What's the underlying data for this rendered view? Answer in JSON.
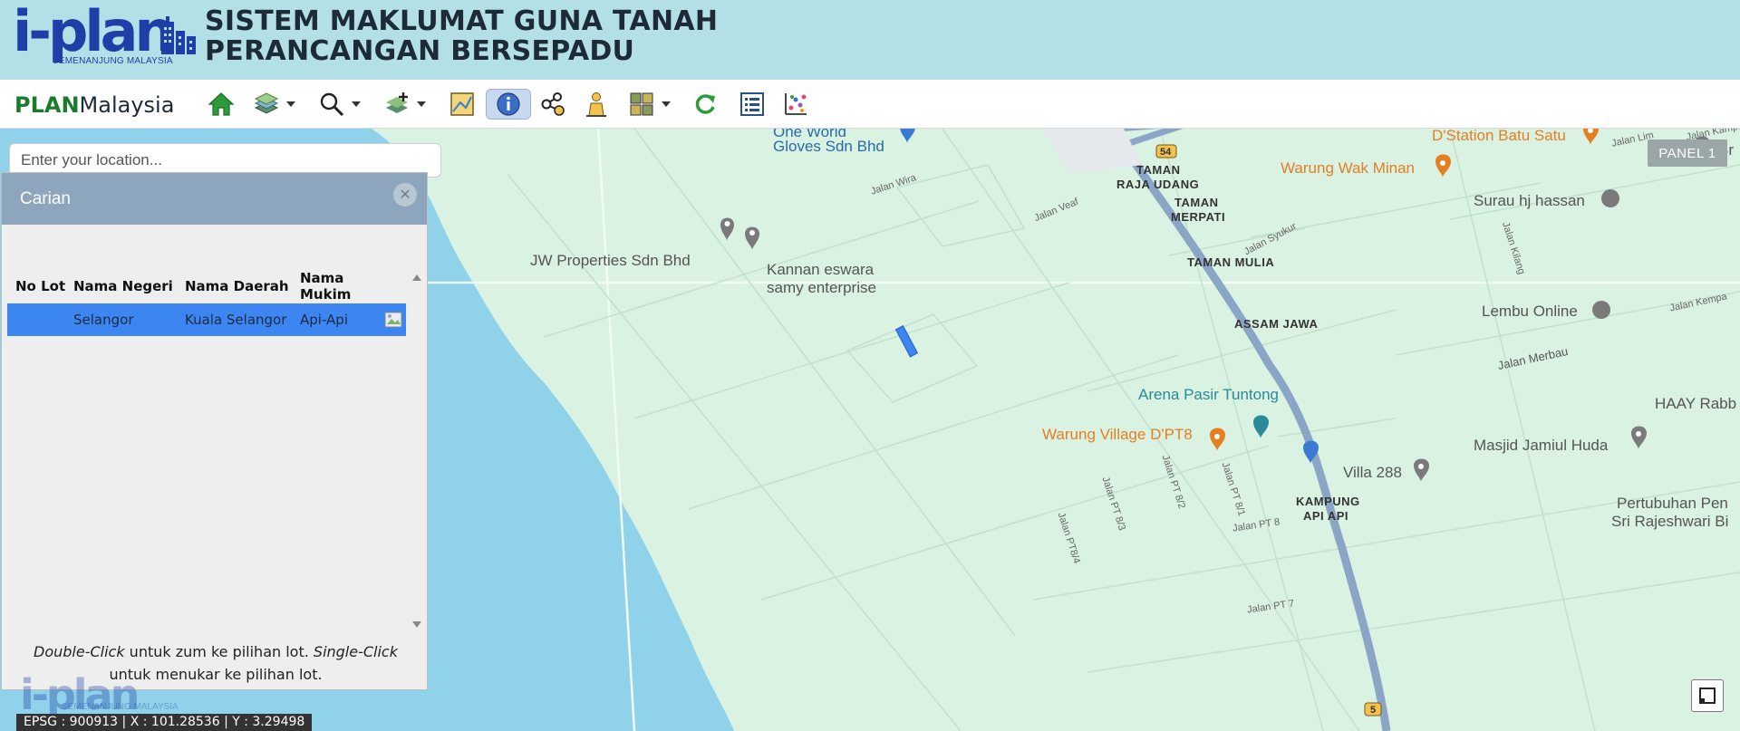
{
  "header": {
    "logo_text": "i-plan",
    "logo_subtitle": "SEMENANJUNG MALAYSIA",
    "title_line1": "SISTEM MAKLUMAT GUNA TANAH",
    "title_line2": "PERANCANGAN BERSEPADU"
  },
  "toolbar": {
    "brand_prefix": "PLAN",
    "brand_suffix": "Malaysia",
    "icons": [
      "home-icon",
      "layers-icon",
      "search-zoom-icon",
      "add-layer-icon",
      "map-legend-icon",
      "info-icon",
      "share-icon",
      "person-icon",
      "grid-icon",
      "refresh-icon",
      "list-icon",
      "chart-icon"
    ]
  },
  "location_search": {
    "placeholder": "Enter your location..."
  },
  "carian": {
    "title": "Carian",
    "columns": [
      "No Lot",
      "Nama Negeri",
      "Nama Daerah",
      "Nama Mukim"
    ],
    "rows": [
      {
        "no_lot": "",
        "negeri": "Selangor",
        "daerah": "Kuala Selangor",
        "mukim": "Api-Api"
      }
    ],
    "hint_italic1": "Double-Click",
    "hint_text1": " untuk zum ke pilihan lot. ",
    "hint_italic2": "Single-Click",
    "hint_text2": " untuk menukar ke pilihan lot."
  },
  "map": {
    "panel_label": "PANEL 1",
    "coord_text": "EPSG : 900913 | X : 101.28536 | Y : 3.29498",
    "watermark_text": "i-plan",
    "watermark_sub": "SEMENANJUNG MALAYSIA",
    "labels": {
      "gloves": "One World Gloves Sdn Bhd",
      "gloves_l1": "One World",
      "gloves_l2": "Gloves Sdn Bhd",
      "jw": "JW Properties Sdn Bhd",
      "kannan_l1": "Kannan eswara",
      "kannan_l2": "samy enterprise",
      "taman_raja_l1": "TAMAN",
      "taman_raja_l2": "RAJA UDANG",
      "taman_merpati_l1": "TAMAN",
      "taman_merpati_l2": "MERPATI",
      "taman_mulia": "TAMAN MULIA",
      "assam_jawa": "ASSAM JAWA",
      "dstation": "D'Station Batu Satu",
      "warung_wak": "Warung Wak Minan",
      "surau": "Surau hj hassan",
      "lembu": "Lembu Online",
      "arena": "Arena Pasir Tuntong",
      "warung_village": "Warung Village D'PT8",
      "haay": "HAAY Rabb",
      "masjid": "Masjid Jamiul Huda",
      "villa": "Villa 288",
      "kampung_l1": "KAMPUNG",
      "kampung_l2": "API API",
      "pertubuhan_l1": "Pertubuhan Pen",
      "pertubuhan_l2": "Sri Rajeshwari Bi",
      "b_right": "Br"
    },
    "roads": {
      "wira": "Jalan Wira",
      "veaf": "Jalan Veaf",
      "syukur": "Jalan Syukur",
      "kilang": "Jalan Kilang",
      "merbau": "Jalan Merbau",
      "kempa": "Jalan Kempa",
      "lim": "Jalan Lim",
      "kampung": "Jalan Kampung",
      "pt8": "Jalan PT 8",
      "pt82": "Jalan PT 8/2",
      "pt81": "Jalan PT 8/1",
      "pt83": "Jalan PT 8/3",
      "pt84": "Jalan PT8/4",
      "pt7": "Jalan PT 7",
      "r54": "54",
      "r5": "5"
    }
  }
}
